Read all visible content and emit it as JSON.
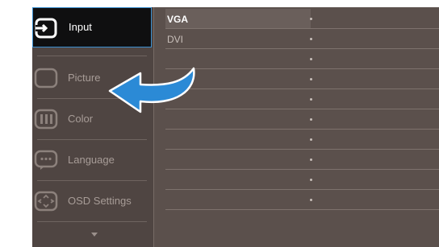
{
  "menu": {
    "items": [
      {
        "label": "Input",
        "icon": "input-icon",
        "selected": true
      },
      {
        "label": "Picture",
        "icon": "picture-icon",
        "selected": false
      },
      {
        "label": "Color",
        "icon": "color-icon",
        "selected": false
      },
      {
        "label": "Language",
        "icon": "language-icon",
        "selected": false
      },
      {
        "label": "OSD Settings",
        "icon": "osd-settings-icon",
        "selected": false
      }
    ],
    "more_icon": "chevron-down-icon"
  },
  "submenu": {
    "options": [
      "VGA",
      "DVI",
      "",
      "",
      "",
      "",
      "",
      "",
      "",
      ""
    ]
  },
  "colors": {
    "selection_border": "#3a8fd0",
    "arrow": "#2b8ad6"
  }
}
